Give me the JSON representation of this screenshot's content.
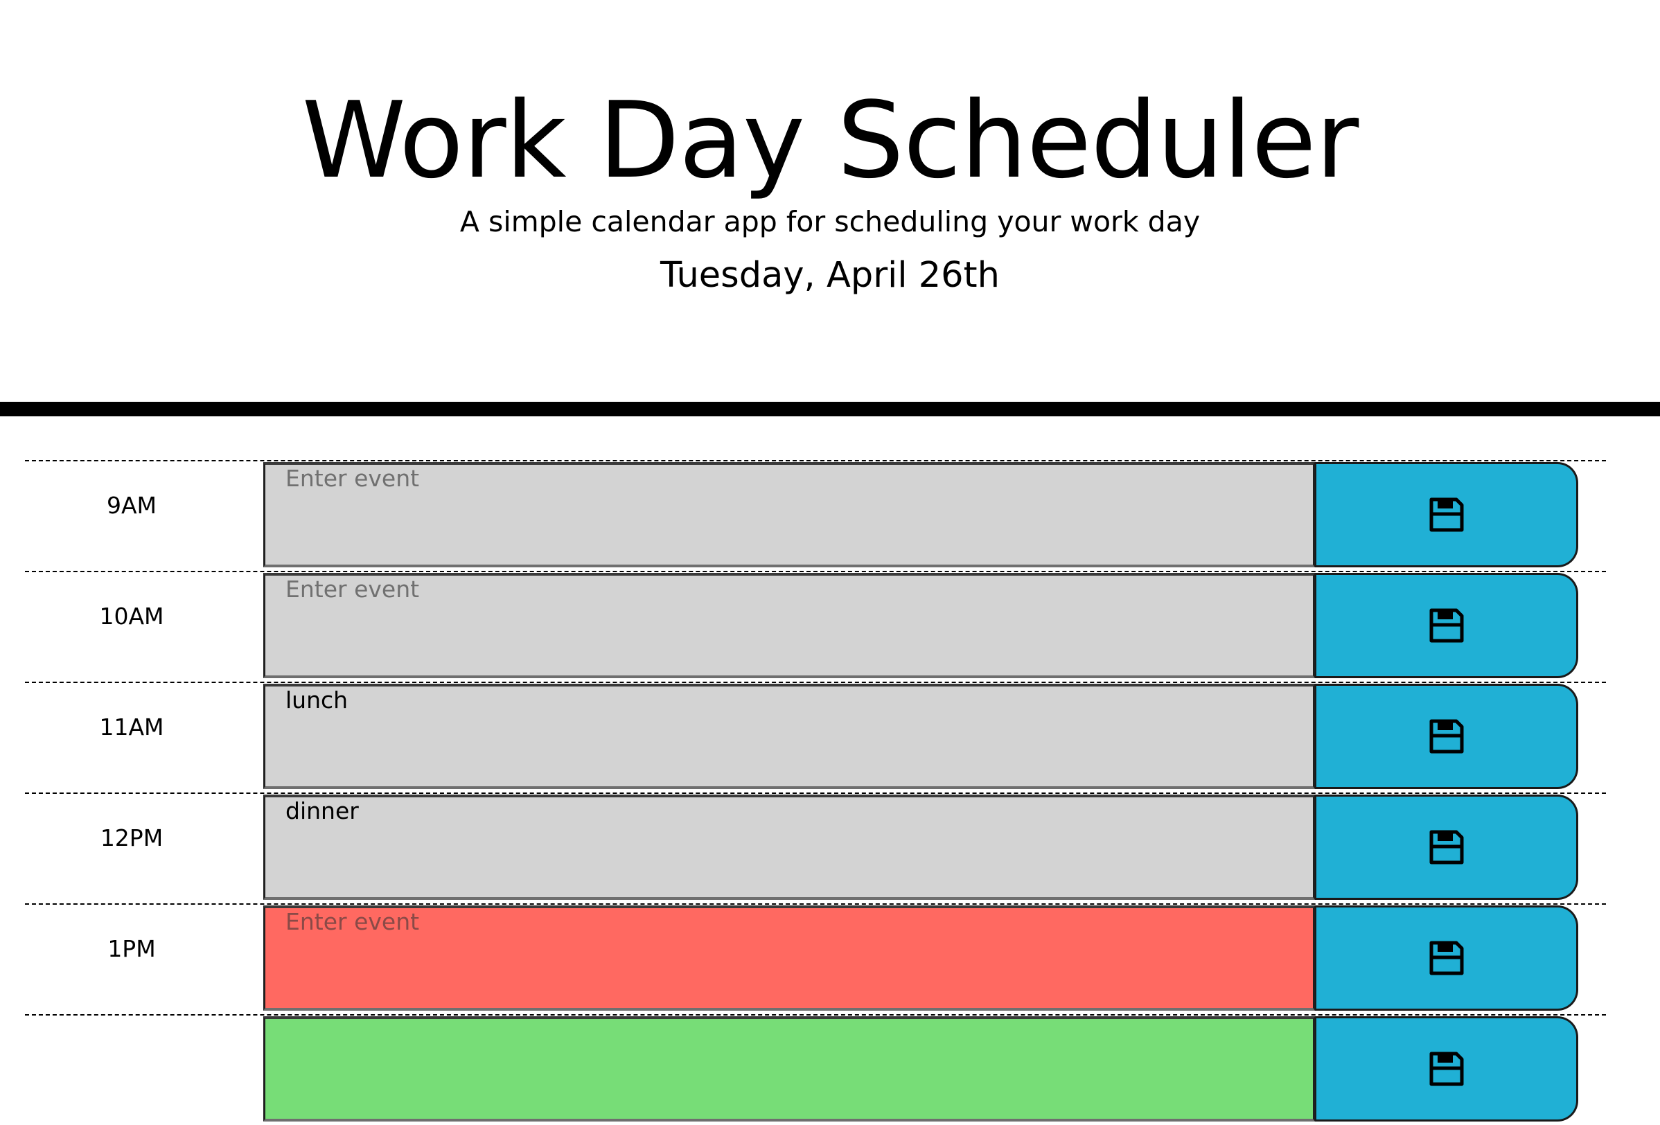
{
  "header": {
    "title": "Work Day Scheduler",
    "subtitle": "A simple calendar app for scheduling your work day",
    "current_day": "Tuesday, April 26th"
  },
  "colors": {
    "past": "#d3d3d3",
    "present": "#ff6961",
    "future": "#77dd77",
    "save_button": "#20b0d5"
  },
  "time_blocks": [
    {
      "hour": "9AM",
      "value": "",
      "placeholder": "Enter event",
      "state": "past",
      "save_icon": "floppy-disk-icon"
    },
    {
      "hour": "10AM",
      "value": "",
      "placeholder": "Enter event",
      "state": "past",
      "save_icon": "floppy-disk-icon"
    },
    {
      "hour": "11AM",
      "value": "lunch",
      "placeholder": "Enter event",
      "state": "past",
      "save_icon": "floppy-disk-icon"
    },
    {
      "hour": "12PM",
      "value": "dinner",
      "placeholder": "Enter event",
      "state": "past",
      "save_icon": "floppy-disk-icon"
    },
    {
      "hour": "1PM",
      "value": "",
      "placeholder": "Enter event",
      "state": "present",
      "save_icon": "floppy-disk-icon"
    },
    {
      "hour": "",
      "value": "",
      "placeholder": "",
      "state": "future",
      "save_icon": "floppy-disk-icon"
    }
  ]
}
